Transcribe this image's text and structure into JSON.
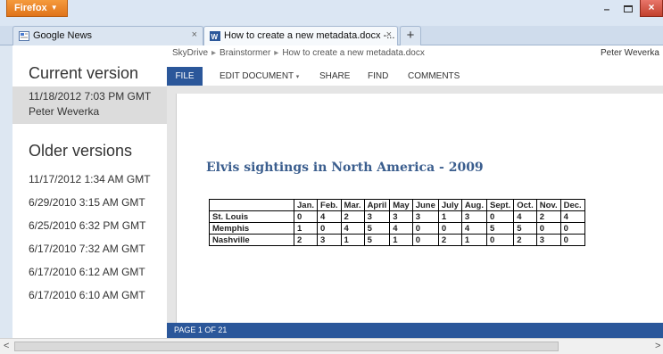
{
  "browser": {
    "menu_button_label": "Firefox",
    "window_controls": {
      "minimize": "–",
      "close": "×"
    },
    "tabs": [
      {
        "label": "Google News",
        "favicon": "news-icon"
      },
      {
        "label": "How to create a new metadata.docx -...",
        "favicon": "word-icon"
      }
    ],
    "new_tab_label": "+"
  },
  "versions_panel": {
    "current_title": "Current version",
    "current": {
      "timestamp": "11/18/2012 7:03 PM GMT",
      "author": "Peter Weverka"
    },
    "older_title": "Older versions",
    "older": [
      "11/17/2012 1:34 AM GMT",
      "6/29/2010 3:15 AM GMT",
      "6/25/2010 6:32 PM GMT",
      "6/17/2010 7:32 AM GMT",
      "6/17/2010 6:12 AM GMT",
      "6/17/2010 6:10 AM GMT"
    ]
  },
  "breadcrumb": [
    "SkyDrive",
    "Brainstormer",
    "How to create a new metadata.docx"
  ],
  "user_name": "Peter Weverka",
  "ribbon": {
    "file": "FILE",
    "edit": "EDIT DOCUMENT",
    "share": "SHARE",
    "find": "FIND",
    "comments": "COMMENTS"
  },
  "document": {
    "heading": "Elvis sightings in North America - 2009",
    "table": {
      "columns": [
        "",
        "Jan.",
        "Feb.",
        "Mar.",
        "April",
        "May",
        "June",
        "July",
        "Aug.",
        "Sept.",
        "Oct.",
        "Nov.",
        "Dec."
      ],
      "rows": [
        {
          "city": "St. Louis",
          "values": [
            "0",
            "4",
            "2",
            "3",
            "3",
            "3",
            "1",
            "3",
            "0",
            "4",
            "2",
            "4"
          ]
        },
        {
          "city": "Memphis",
          "values": [
            "1",
            "0",
            "4",
            "5",
            "4",
            "0",
            "0",
            "4",
            "5",
            "5",
            "0",
            "0"
          ]
        },
        {
          "city": "Nashville",
          "values": [
            "2",
            "3",
            "1",
            "5",
            "1",
            "0",
            "2",
            "1",
            "0",
            "2",
            "3",
            "0"
          ]
        }
      ]
    }
  },
  "status_bar": "PAGE 1 OF 21",
  "colors": {
    "word_blue": "#2b579a",
    "firefox_orange": "#e0741a",
    "heading_blue": "#3b5e8e"
  }
}
